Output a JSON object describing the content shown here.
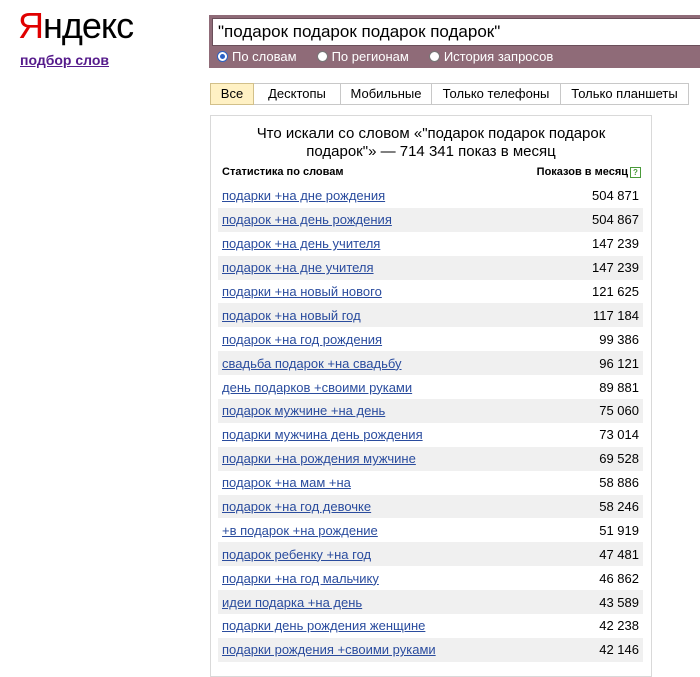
{
  "logo": {
    "first": "Я",
    "rest": "ндекс"
  },
  "subtitle": "подбор слов",
  "search": {
    "value": "\"подарок подарок подарок подарок\"",
    "radios": [
      {
        "label": "По словам",
        "checked": true
      },
      {
        "label": "По регионам",
        "checked": false
      },
      {
        "label": "История запросов",
        "checked": false
      }
    ]
  },
  "tabs": [
    {
      "label": "Все",
      "active": true
    },
    {
      "label": "Десктопы",
      "active": false
    },
    {
      "label": "Мобильные",
      "active": false
    },
    {
      "label": "Только телефоны",
      "active": false
    },
    {
      "label": "Только планшеты",
      "active": false
    }
  ],
  "panel": {
    "title_line1": "Что искали со словом «\"подарок подарок подарок",
    "title_line2": "подарок\"» — 714 341 показ в месяц",
    "col_left": "Статистика по словам",
    "col_right": "Показов в месяц",
    "help_icon": "question-icon",
    "rows": [
      {
        "phrase": "подарки +на дне рождения",
        "count": "504 871"
      },
      {
        "phrase": "подарок +на день рождения",
        "count": "504 867"
      },
      {
        "phrase": "подарок +на день учителя",
        "count": "147 239"
      },
      {
        "phrase": "подарок +на дне учителя",
        "count": "147 239"
      },
      {
        "phrase": "подарки +на новый нового",
        "count": "121 625"
      },
      {
        "phrase": "подарок +на новый год",
        "count": "117 184"
      },
      {
        "phrase": "подарок +на год рождения",
        "count": "99 386"
      },
      {
        "phrase": "свадьба подарок +на свадьбу",
        "count": "96 121"
      },
      {
        "phrase": "день подарков +своими руками",
        "count": "89 881"
      },
      {
        "phrase": "подарок мужчине +на день",
        "count": "75 060"
      },
      {
        "phrase": "подарки мужчина день рождения",
        "count": "73 014"
      },
      {
        "phrase": "подарки +на рождения мужчине",
        "count": "69 528"
      },
      {
        "phrase": "подарок +на мам +на",
        "count": "58 886"
      },
      {
        "phrase": "подарок +на год девочке",
        "count": "58 246"
      },
      {
        "phrase": "+в подарок +на рождение",
        "count": "51 919"
      },
      {
        "phrase": "подарок ребенку +на год",
        "count": "47 481"
      },
      {
        "phrase": "подарки +на год мальчику",
        "count": "46 862"
      },
      {
        "phrase": "идеи подарка +на день",
        "count": "43 589"
      },
      {
        "phrase": "подарки день рождения женщине",
        "count": "42 238"
      },
      {
        "phrase": "подарки рождения +своими руками",
        "count": "42 146"
      }
    ]
  },
  "colors": {
    "logo_red": "#e00000",
    "search_frame": "#8f6b78",
    "link": "#2a4c9e",
    "active_tab": "#fff1c4"
  }
}
